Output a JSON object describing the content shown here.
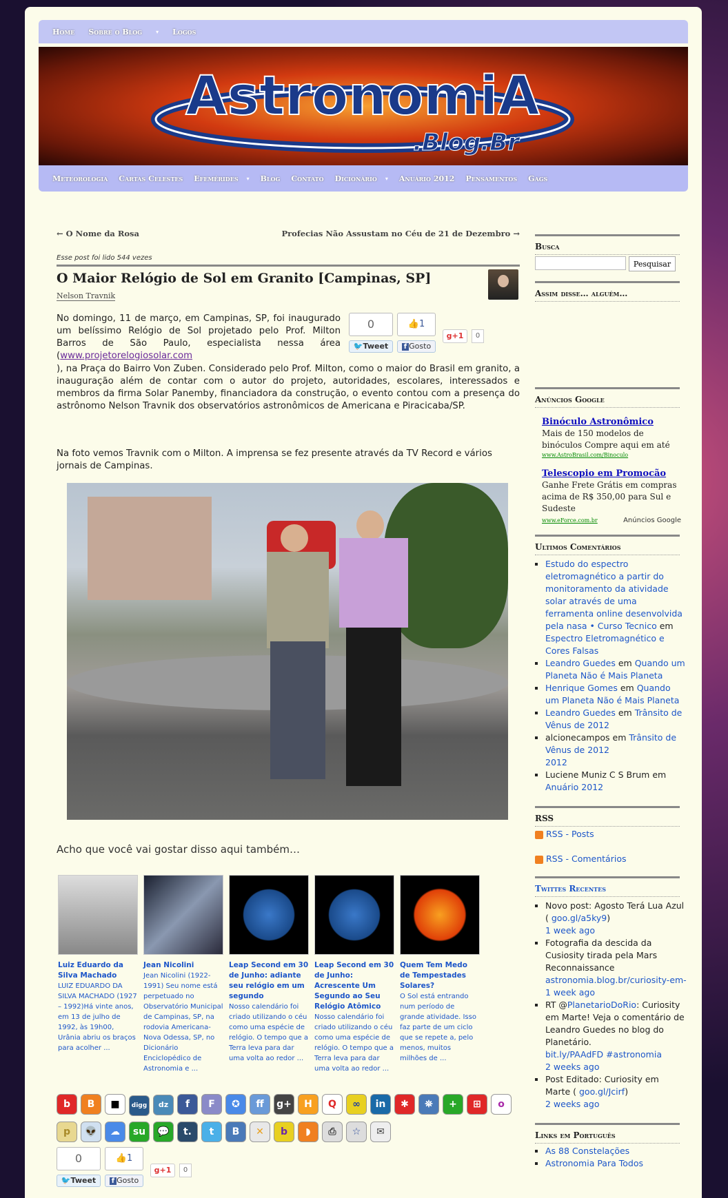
{
  "top_nav": [
    "Home",
    "Sobre o Blog",
    "Logos"
  ],
  "banner": {
    "title": "AstronomiA",
    ".blog": ".Blog.Br"
  },
  "main_nav": [
    "Meteorologia",
    "Cartas Celestes",
    "Efemérides",
    "Blog",
    "Contato",
    "Dicionário",
    "Anuário 2012",
    "Pensamentos",
    "Gags"
  ],
  "post_nav": {
    "prev": "← O Nome da Rosa",
    "next": "Profecias Não Assustam no Céu de 21 de Dezembro →"
  },
  "views": "Esse post foi lido 544 vezes",
  "post": {
    "title": "O Maior Relógio de Sol em Granito [Campinas, SP]",
    "author": "Nelson Travnik",
    "p1a": "No domingo, 11 de março, em Campinas, SP, foi inaugurado um belíssimo Relógio de Sol projetado pelo Prof. Milton Barros de São Paulo, especialista nessa área (",
    "p1link": "www.projetorelogiosolar.com",
    "p1b": "), na Praça do Bairro Von Zuben. Considerado pelo Prof. Milton, como o maior do Brasil em granito, a inauguração além de contar com o autor do projeto, autoridades, escolares, interessados e membros da firma Solar Panemby, financiadora da construção, o evento contou com a presença do astrônomo Nelson Travnik dos observatórios astronômicos de Americana e Piracicaba/SP.",
    "p2": "Na foto vemos Travnik com o Milton. A imprensa se fez presente através da TV Record e vários jornais de Campinas.",
    "related_title": "Acho que você vai gostar disso aqui também…"
  },
  "share": {
    "count": "0",
    "tweet": "Tweet",
    "like_count": "1",
    "like": "Gosto",
    "gplus": "+1",
    "gplus_count": "0"
  },
  "related": [
    {
      "title": "Luiz Eduardo da Silva Machado",
      "text": "LUIZ EDUARDO DA SILVA MACHADO (1927 – 1992)Há vinte anos, em 13 de julho de 1992, às 19h00, Urânia abriu os braços para acolher ..."
    },
    {
      "title": "Jean Nicolini",
      "text": "Jean Nicolini (1922-1991) Seu nome está perpetuado no Observatório Municipal de Campinas, SP, na rodovia Americana-Nova Odessa, SP, no Dicionário Enciclopédico de Astronomia e ..."
    },
    {
      "title": "Leap Second em 30 de Junho: adiante seu relógio em um segundo",
      "text": "Nosso calendário foi criado utilizando o céu como uma espécie de relógio. O tempo que a Terra leva para dar uma volta ao redor ..."
    },
    {
      "title": "Leap Second em 30 de Junho: Acrescente Um Segundo ao Seu Relógio Atômico",
      "text": "Nosso calendário foi criado utilizando o céu como uma espécie de relógio. O tempo que a Terra leva para dar uma volta ao redor ..."
    },
    {
      "title": "Quem Tem Medo de Tempestades Solares?",
      "text": "O Sol está entrando num período de grande atividade. Isso faz parte de um ciclo que se repete a, pelo menos, muitos milhões de ..."
    }
  ],
  "sidebar": {
    "busca": "Busca",
    "search_btn": "Pesquisar",
    "assim": "Assim disse… alguém…",
    "ads_h": "Anúncios Google",
    "ad1_t": "Binóculo Astronômico",
    "ad1_d": "Mais de 150 modelos de binóculos Compre aqui em até",
    "ad1_u": "www.AstroBrasil.com/Binoculo",
    "ad2_t": "Telescopio em Promocão",
    "ad2_d": "Ganhe Frete Grátis em compras acima de R$ 350,00 para Sul e Sudeste",
    "ad2_u": "www.eForce.com.br",
    "ads_by": "Anúncios Google",
    "comments_h": "Ultimos Comentários",
    "c1a": "Estudo do espectro eletromagnético a partir do monitoramento da atividade solar através de uma ferramenta online desenvolvida pela nasa • Curso Tecnico",
    "c1b": " em ",
    "c1c": "Espectro Eletromagnético e Cores Falsas",
    "c2a": "Leandro Guedes",
    "c2b": " em ",
    "c2c": "Quando um Planeta Não é Mais Planeta",
    "c3a": "Henrique Gomes",
    "c3b": " em ",
    "c3c": "Quando um Planeta Não é Mais Planeta",
    "c4a": "Leandro Guedes",
    "c4b": " em ",
    "c4c": "Trânsito de Vênus de 2012",
    "c5a": "alcionecampos em ",
    "c5c": "Trânsito de Vênus de 2012",
    "c5d": "2012",
    "c6a": "Luciene Muniz C S Brum em ",
    "c6c": "Anuário 2012",
    "rss_h": "RSS",
    "rss1": "RSS - Posts",
    "rss2": "RSS - Comentários",
    "tw_h": "Twittes Recentes",
    "t1a": "Novo post: Agosto Terá Lua Azul ( ",
    "t1l": "goo.gl/a5ky9",
    "t1b": ")",
    "t1d": "1 week ago",
    "t2a": "Fotografia da descida da Cusiosity tirada pela Mars Reconnaissance",
    "t2l": "astronomia.blog.br/curiosity-em-",
    "t2d": "1 week ago",
    "t3a": "RT @",
    "t3l": "PlanetarioDoRio",
    "t3b": ": Curiosity em Marte! Veja o comentário de Leandro Guedes no blog do Planetário.",
    "t3l2": "bit.ly/PAAdFD #astronomia",
    "t3d": "2 weeks ago",
    "t4a": "Post Editado: Curiosity em Marte ( ",
    "t4l": "goo.gl/Jcirf",
    "t4b": ")",
    "t4d": "2 weeks ago",
    "links_h": "Links em Português",
    "l1": "As 88 Constelações",
    "l2": "Astronomia Para Todos"
  },
  "colors": {
    "link": "#1d56c9",
    "nav": "#b6baf4",
    "page": "#fcfcea"
  }
}
